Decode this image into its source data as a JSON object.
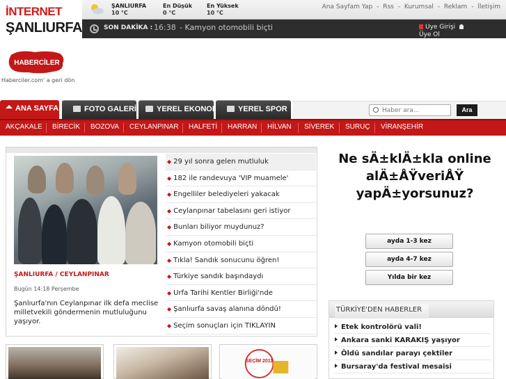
{
  "brand": {
    "line1": "İNTERNET",
    "line2": "ŞANLIURFA"
  },
  "weather": {
    "icon": "partly-sunny-icon",
    "city_label": "ŞANLIURFA",
    "city_value": "10 °C",
    "low_label": "En Düşük",
    "low_value": "0 °C",
    "high_label": "En Yüksek",
    "high_value": "10 °C"
  },
  "top_links": [
    "Ana Sayfam Yap",
    "-",
    "Rss",
    "-",
    "Kurumsal",
    "-",
    "Reklam",
    "-",
    "İletişim"
  ],
  "breaking": {
    "label": "SON DAKİKA :",
    "time": "16:38",
    "separator": "-",
    "text": "Kamyon otomobili biçti"
  },
  "member": {
    "login": "Üye Girişi",
    "register": "Üye Ol"
  },
  "haberciler": {
    "logo_text": "HABERCİLER",
    "back_link": "Haberciler.com' a geri dön"
  },
  "nav": {
    "tabs": [
      {
        "label": "ANA SAYFA",
        "icon": "home-icon"
      },
      {
        "label": "FOTO GALERİ",
        "icon": "camera-icon"
      },
      {
        "label": "YEREL EKONOMİ",
        "icon": "document-icon"
      },
      {
        "label": "YEREL SPOR",
        "icon": "document-icon"
      }
    ],
    "search_placeholder": "Haber ara...",
    "search_button": "Ara"
  },
  "districts": [
    "AKÇAKALE",
    "BİRECİK",
    "BOZOVA",
    "CEYLANPINAR",
    "HALFETİ",
    "HARRAN",
    "HİLVAN",
    "SİVEREK",
    "SURUÇ",
    "VİRANŞEHİR"
  ],
  "headline": {
    "location": "ŞANLIURFA / CEYLANPINAR",
    "date": "Bugün 14:18 Perşembe",
    "summary": "Şanlıurfa'nın Ceylanpınar ilk defa meclise milletvekili göndermenin mutluluğunu yaşıyor."
  },
  "news": [
    "29 yıl sonra gelen mutluluk",
    "182 ile randevuya 'VIP muamele'",
    "Engelliler belediyeleri yakacak",
    "Ceylanpınar tabelasını geri istiyor",
    "Bunları biliyor muydunuz?",
    "Kamyon otomobili biçti",
    "Tıkla! Sandık sonucunu öğren!",
    "Türkiye sandık başındaydı",
    "Urfa Tarihi Kentler Birliği'nde",
    "Şanlıurfa savaş alanına döndü!",
    "Seçim sonuçları için TIKLAYIN"
  ],
  "thumb_text": "SEÇİM 2011",
  "poll": {
    "question": "Ne sÄ±klÄ±kla online alÄ±ÅŸveriÅŸ yapÄ±yorsunuz?",
    "options": [
      "ayda 1-3 kez",
      "ayda 4-7 kez",
      "Yılda bir kez"
    ]
  },
  "turkey_news": {
    "title": "TÜRKİYE'DEN HABERLER",
    "items": [
      "Etek kontrolörü vali!",
      "Ankara sanki KARAKIŞ yaşıyor",
      "Öldü sandılar parayı çektiler",
      "Bursaray'da festival mesaisi"
    ]
  },
  "colors": {
    "brand_red": "#c41717",
    "dark_bar": "#2d2d2d"
  }
}
